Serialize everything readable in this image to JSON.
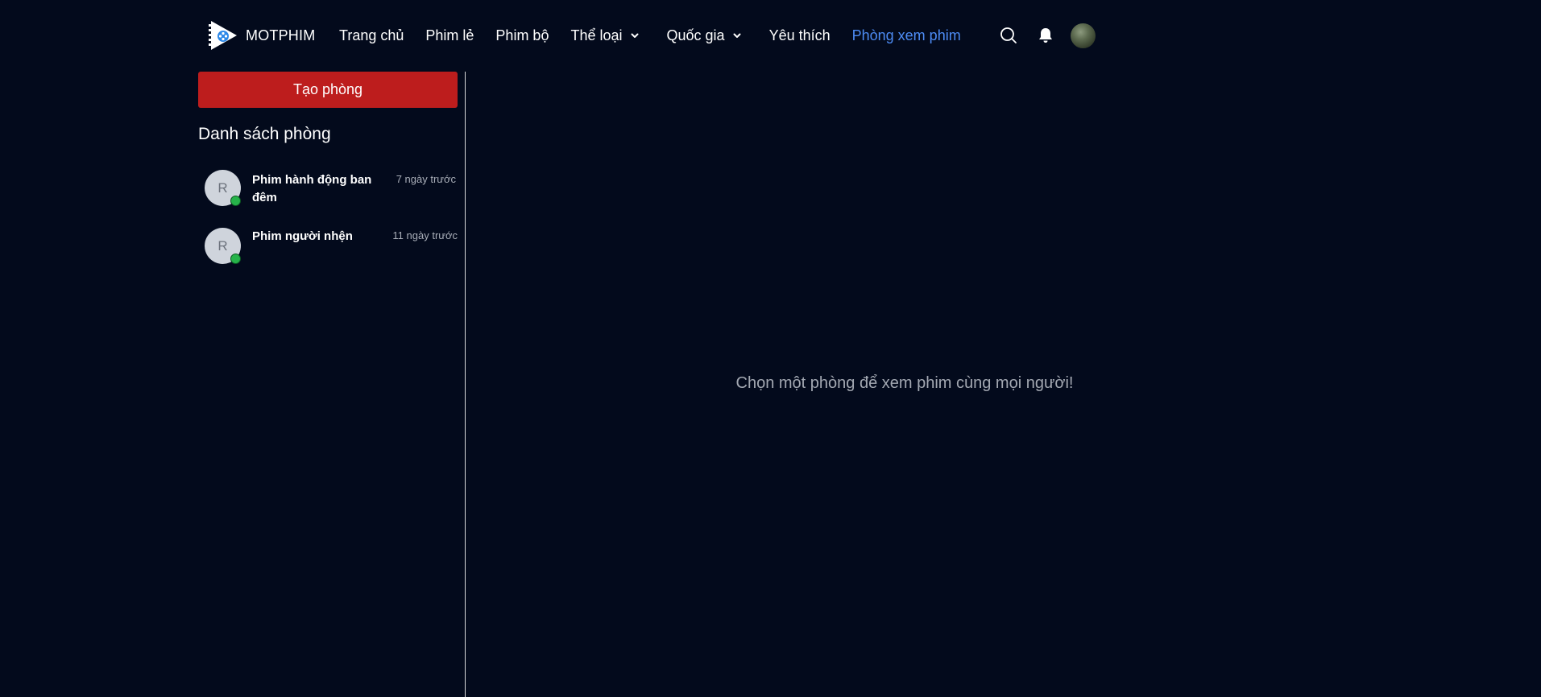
{
  "header": {
    "brand": "MOTPHIM",
    "nav": [
      {
        "label": "Trang chủ",
        "active": false,
        "dropdown": false
      },
      {
        "label": "Phim lẻ",
        "active": false,
        "dropdown": false
      },
      {
        "label": "Phim bộ",
        "active": false,
        "dropdown": false
      },
      {
        "label": "Thể loại",
        "active": false,
        "dropdown": true
      },
      {
        "label": "Quốc gia",
        "active": false,
        "dropdown": true
      },
      {
        "label": "Yêu thích",
        "active": false,
        "dropdown": false
      },
      {
        "label": "Phòng xem phim",
        "active": true,
        "dropdown": false
      }
    ],
    "icons": [
      "search-icon",
      "bell-icon",
      "user-avatar"
    ]
  },
  "sidebar": {
    "create_button": "Tạo phòng",
    "title": "Danh sách phòng",
    "rooms": [
      {
        "initial": "R",
        "name": "Phim hành động ban đêm",
        "time": "7 ngày trước",
        "online": true
      },
      {
        "initial": "R",
        "name": "Phim người nhện",
        "time": "11 ngày trước",
        "online": true
      }
    ]
  },
  "main": {
    "empty_message": "Chọn một phòng để xem phim cùng mọi người!"
  },
  "colors": {
    "background": "#030a1c",
    "accent_active": "#4d8cf5",
    "create_button": "#bd1d1d",
    "online": "#26b34a",
    "muted_text": "#a3a8b2"
  }
}
